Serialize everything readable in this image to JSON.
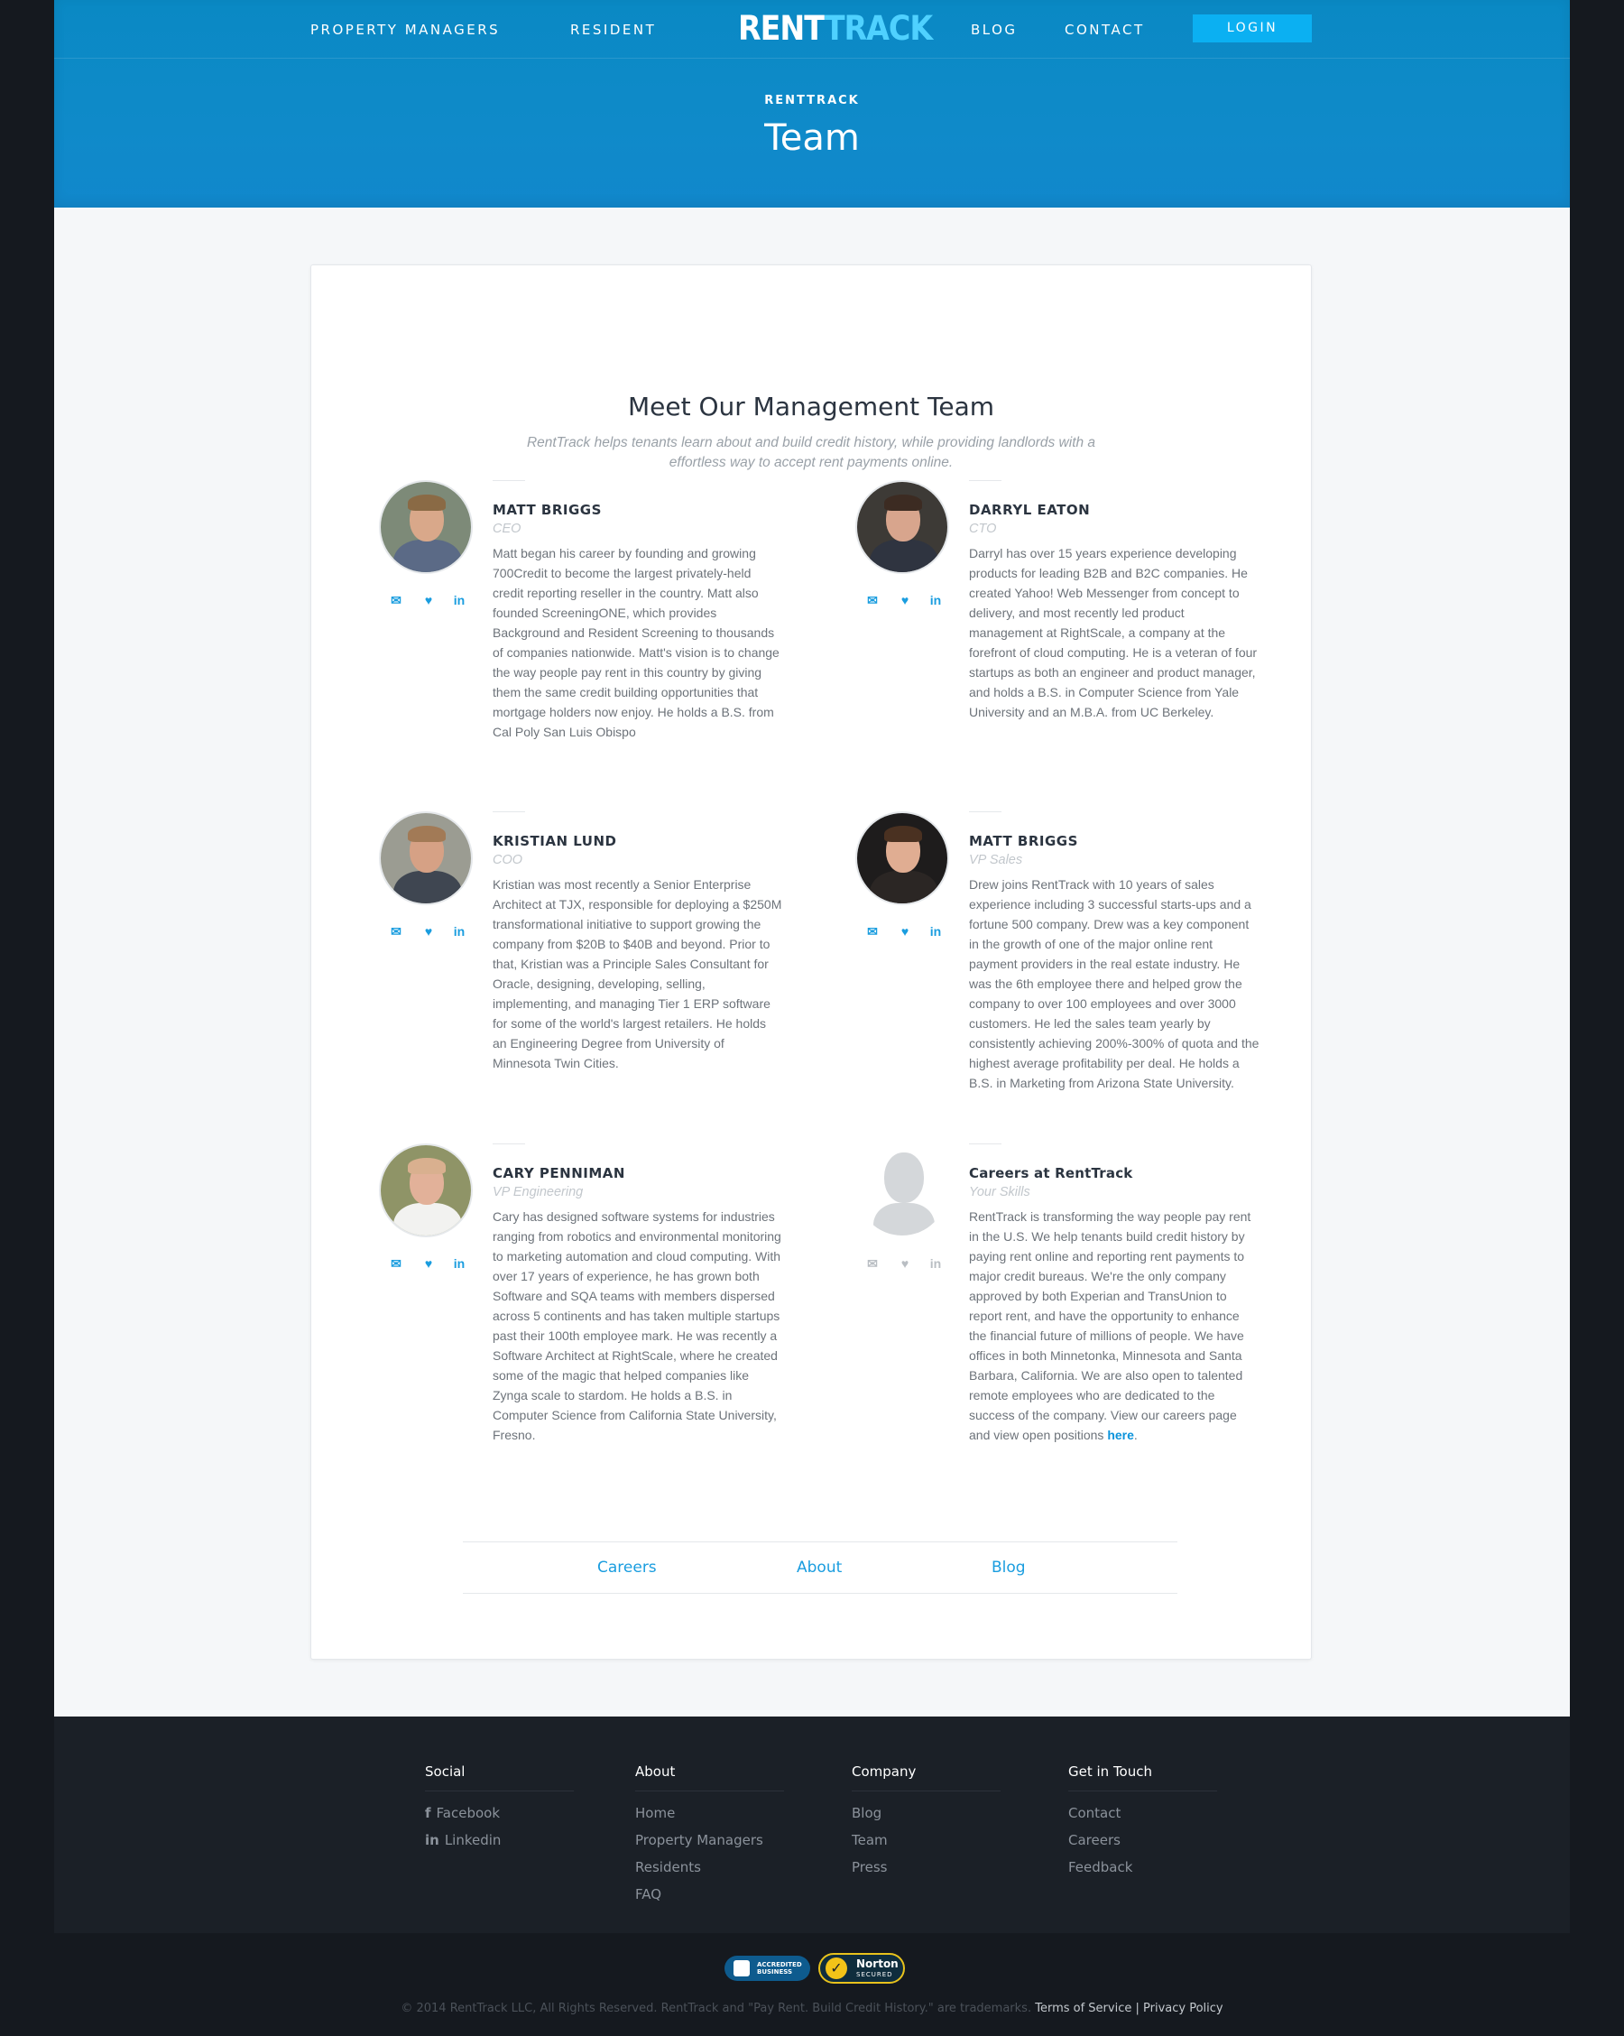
{
  "nav": {
    "items": [
      "PROPERTY MANAGERS",
      "RESIDENT",
      "BLOG",
      "CONTACT"
    ],
    "logo_part1": "RENT",
    "logo_part2": "TRACK",
    "login": "LOGIN"
  },
  "hero": {
    "eyebrow": "RENTTRACK",
    "title": "Team"
  },
  "section": {
    "heading": "Meet Our Management Team",
    "intro": "RentTrack helps tenants learn about and build credit history, while providing landlords with a effortless way to accept rent payments online."
  },
  "members": [
    {
      "name": "MATT BRIGGS",
      "role": "CEO",
      "bio": "Matt began his career by founding and growing 700Credit to become the largest privately-held credit reporting reseller in the country. Matt also founded ScreeningONE, which provides Background and Resident Screening to thousands of companies nationwide. Matt's vision is to change the way people pay rent in this country by giving them the same credit building opportunities that mortgage holders now enjoy. He holds a B.S. from Cal Poly San Luis Obispo"
    },
    {
      "name": "DARRYL EATON",
      "role": "CTO",
      "bio": "Darryl has over 15 years experience developing products for leading B2B and B2C companies. He created Yahoo! Web Messenger from concept to delivery, and most recently led product management at RightScale, a company at the forefront of cloud computing. He is a veteran of four startups as both an engineer and product manager, and holds a B.S. in Computer Science from Yale University and an M.B.A. from UC Berkeley."
    },
    {
      "name": "KRISTIAN LUND",
      "role": "COO",
      "bio": "Kristian was most recently a Senior Enterprise Architect at TJX, responsible for deploying a $250M transformational initiative to support growing the company from $20B to $40B and beyond. Prior to that, Kristian was a Principle Sales Consultant for Oracle, designing, developing, selling, implementing, and managing Tier 1 ERP software for some of the world's largest retailers. He holds an Engineering Degree from University of Minnesota Twin Cities."
    },
    {
      "name": "MATT BRIGGS",
      "role": "VP Sales",
      "bio": "Drew joins RentTrack with 10 years of sales experience including 3 successful starts-ups and a fortune 500 company. Drew was a key component in the growth of one of the major online rent payment providers in the real estate industry. He was the 6th employee there and helped grow the company to over 100 employees and over 3000 customers. He led the sales team yearly by consistently achieving 200%-300% of quota and the highest average profitability per deal. He holds a B.S. in Marketing from Arizona State University."
    },
    {
      "name": "CARY PENNIMAN",
      "role": "VP Engineering",
      "bio": "Cary has designed software systems for industries ranging from robotics and environmental monitoring to marketing automation and cloud computing. With over 17 years of experience, he has grown both Software and SQA teams with members dispersed across 5 continents and has taken multiple startups past their 100th employee mark. He was recently a Software Architect at RightScale, where he created some of the magic that helped companies like Zynga scale to stardom. He holds a B.S. in Computer Science from California State University, Fresno."
    },
    {
      "name": "Careers at RentTrack",
      "role": "Your Skills",
      "bio": "RentTrack is transforming the way people pay rent in the U.S. We help tenants build credit history by paying rent online and reporting rent payments to major credit bureaus. We're the only company approved by both Experian and TransUnion to report rent, and have the opportunity to enhance the financial future of millions of people. We have offices in both Minnetonka, Minnesota and Santa Barbara, California. We are also open to talented remote employees who are dedicated to the success of the company. View our careers page and view open positions ",
      "link": "here",
      "after_link": "."
    }
  ],
  "bottom_links": [
    "Careers",
    "About",
    "Blog"
  ],
  "footer": {
    "social": {
      "title": "Social",
      "items": [
        "Facebook",
        "Linkedin"
      ]
    },
    "about": {
      "title": "About",
      "items": [
        "Home",
        "Property Managers",
        "Residents",
        "FAQ"
      ]
    },
    "company": {
      "title": "Company",
      "items": [
        "Blog",
        "Team",
        "Press"
      ]
    },
    "contact": {
      "title": "Get in Touch",
      "items": [
        "Contact",
        "Careers",
        "Feedback"
      ]
    }
  },
  "badges": {
    "bbb": "ACCREDITED BUSINESS",
    "norton": "Norton",
    "norton_sub": "SECURED"
  },
  "legal": {
    "copyright": "© 2014 RentTrack LLC, All Rights Reserved. RentTrack and \"Pay Rent. Build Credit History.\" are trademarks.",
    "terms": "Terms of Service",
    "sep": "|",
    "privacy": "Privacy Policy"
  },
  "icons": [
    "envelope-icon",
    "twitter-icon",
    "linkedin-icon",
    "facebook-icon"
  ],
  "colors": {
    "primary": "#0f8ac9",
    "accent": "#1a9ddf",
    "footer": "#1b2027"
  }
}
